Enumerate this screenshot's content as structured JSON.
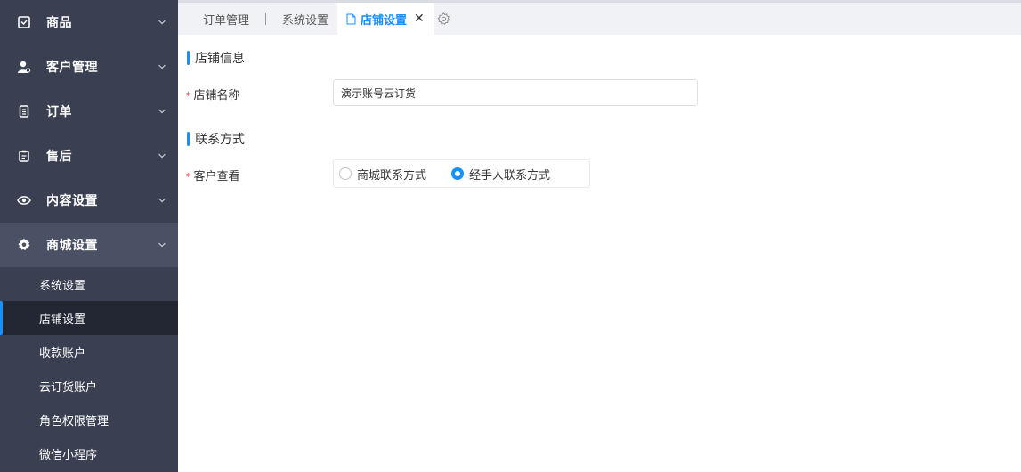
{
  "sidebar": {
    "menu": [
      {
        "label": "商品",
        "icon": "box-check-icon"
      },
      {
        "label": "客户管理",
        "icon": "user-icon"
      },
      {
        "label": "订单",
        "icon": "receipt-icon"
      },
      {
        "label": "售后",
        "icon": "clipboard-icon"
      },
      {
        "label": "内容设置",
        "icon": "eye-icon"
      },
      {
        "label": "商城设置",
        "icon": "gear-icon"
      }
    ],
    "submenu": [
      {
        "label": "系统设置"
      },
      {
        "label": "店铺设置"
      },
      {
        "label": "收款账户"
      },
      {
        "label": "云订货账户"
      },
      {
        "label": "角色权限管理"
      },
      {
        "label": "微信小程序"
      }
    ]
  },
  "tabs": [
    {
      "label": "订单管理"
    },
    {
      "label": "系统设置"
    },
    {
      "label": "店铺设置"
    }
  ],
  "sections": {
    "store_info": {
      "title": "店铺信息"
    },
    "contact": {
      "title": "联系方式"
    }
  },
  "form": {
    "store_name": {
      "label": "店铺名称",
      "required_mark": "*",
      "value": "演示账号云订货"
    },
    "customer_view": {
      "label": "客户查看",
      "required_mark": "*",
      "options": [
        {
          "label": "商城联系方式",
          "checked": false
        },
        {
          "label": "经手人联系方式",
          "checked": true
        }
      ]
    }
  },
  "colors": {
    "accent": "#1890ff",
    "sidebar_bg": "#3a3f51",
    "required": "#f5222d"
  }
}
